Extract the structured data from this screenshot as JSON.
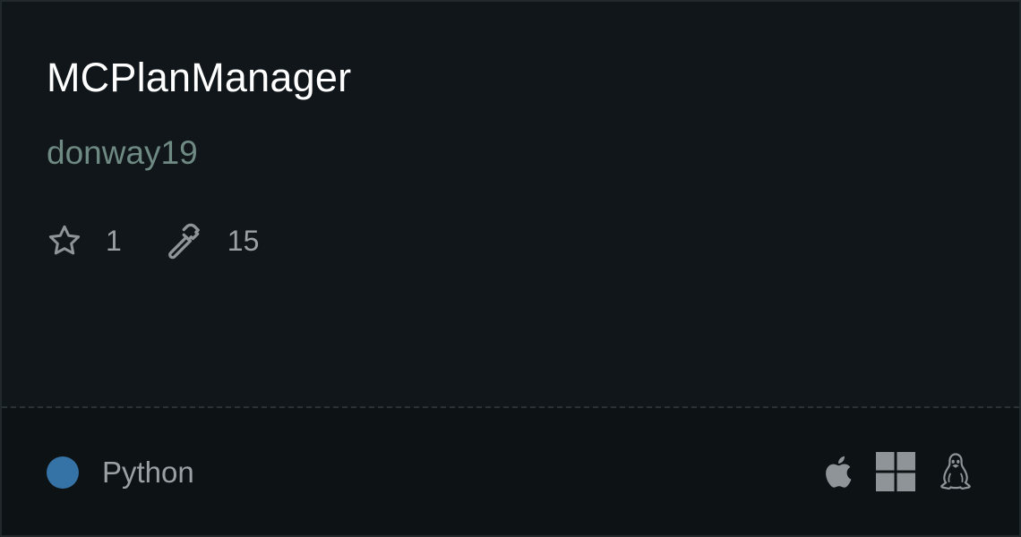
{
  "repo": {
    "name": "MCPlanManager",
    "owner": "donway19"
  },
  "stats": {
    "stars": "1",
    "star_icon": "star-icon",
    "builds": "15",
    "build_icon": "hammer-icon"
  },
  "language": {
    "name": "Python",
    "color": "#3572a5"
  },
  "platforms": [
    {
      "icon": "apple-icon"
    },
    {
      "icon": "windows-icon"
    },
    {
      "icon": "linux-icon"
    }
  ],
  "colors": {
    "background": "#101619",
    "title": "#ffffff",
    "owner": "#6f8a83",
    "muted": "#9aa0a3",
    "icon": "#8e9497"
  }
}
